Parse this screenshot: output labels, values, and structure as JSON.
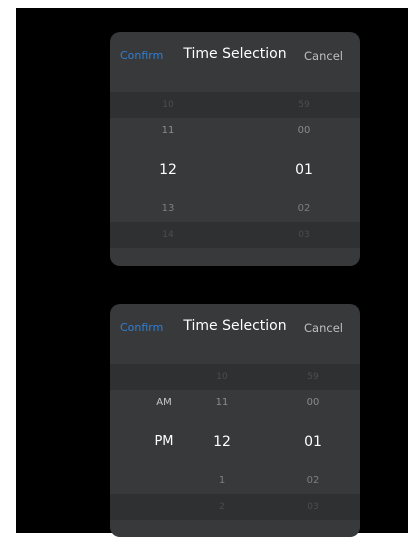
{
  "pickers": [
    {
      "confirm_label": "Confirm",
      "title": "Time Selection",
      "cancel_label": "Cancel",
      "hours": [
        "10",
        "11",
        "12",
        "13",
        "14"
      ],
      "minutes": [
        "59",
        "00",
        "01",
        "02",
        "03"
      ],
      "selected_hour": "12",
      "selected_minute": "01"
    },
    {
      "confirm_label": "Confirm",
      "title": "Time Selection",
      "cancel_label": "Cancel",
      "ampm": [
        "AM",
        "PM"
      ],
      "hours": [
        "10",
        "11",
        "12",
        "1",
        "2"
      ],
      "minutes": [
        "59",
        "00",
        "01",
        "02",
        "03"
      ],
      "selected_ampm": "PM",
      "selected_hour": "12",
      "selected_minute": "01"
    }
  ],
  "colors": {
    "background": "#000000",
    "panel": "#38393b",
    "band": "#2f3032",
    "accent": "#2f7fd4",
    "title": "#ffffff",
    "cancel": "#bfbfbf"
  }
}
